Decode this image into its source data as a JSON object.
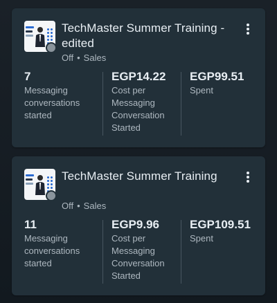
{
  "campaigns": [
    {
      "title": "TechMaster Summer Training -  edited",
      "status": "Off",
      "separator": "•",
      "objective": "Sales",
      "metrics": [
        {
          "value": "7",
          "label": "Messaging conversations started"
        },
        {
          "value": "EGP14.22",
          "label": "Cost per Messaging Conversation Started"
        },
        {
          "value": "EGP99.51",
          "label": "Spent"
        }
      ]
    },
    {
      "title": "TechMaster Summer Training",
      "status": "Off",
      "separator": "•",
      "objective": "Sales",
      "metrics": [
        {
          "value": "11",
          "label": "Messaging conversations started"
        },
        {
          "value": "EGP9.96",
          "label": "Cost per Messaging Conversation Started"
        },
        {
          "value": "EGP109.51",
          "label": "Spent"
        }
      ]
    }
  ],
  "colors": {
    "card_background": "#223039",
    "page_background": "#12191f",
    "primary_text": "#e8eef3",
    "secondary_text": "#aeb8c0",
    "status_off": "#8a949c",
    "divider": "#485660"
  },
  "icons": {
    "menu": "more-vertical-icon",
    "thumbnail": "ad-thumbnail-image",
    "status": "off-status-dot"
  }
}
